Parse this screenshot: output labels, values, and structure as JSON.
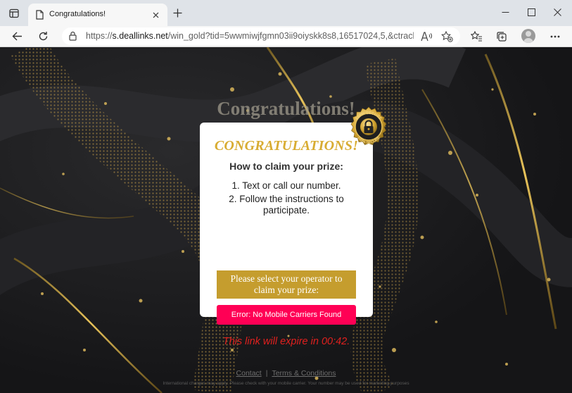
{
  "browser": {
    "tab": {
      "title": "Congratulations!"
    },
    "url": {
      "scheme": "https://",
      "host": "s.deallinks.net",
      "path": "/win_gold?tid=5wwmiwjfgmn03ii9oiyskk8s8,16517024,5,&ctrack=16..."
    }
  },
  "page": {
    "background_heading": "Congratulations!",
    "modal": {
      "title": "CONGRATULATIONS!",
      "howto": "How to claim your prize:",
      "steps": [
        "1. Text or call our number.",
        "2. Follow the instructions to participate."
      ],
      "operator_prompt": "Please select your operator to claim your prize:",
      "error_button": "Error: No Mobile Carriers Found",
      "expire_prefix": "This link will expire in",
      "countdown": "00:42",
      "expire_suffix": "."
    },
    "seal": {
      "top_text": "100% SECURE",
      "bottom_text": "100% SECURE"
    },
    "footer": {
      "contact": "Contact",
      "separator": "|",
      "terms": "Terms & Conditions",
      "note": "International charges may apply. Please check with your mobile carrier. Your number may be used for marketing purposes"
    }
  },
  "colors": {
    "gold": "#c59d2e",
    "title_gold": "#d8ac32",
    "error": "#ff0055",
    "expire_red": "#e0201e"
  }
}
